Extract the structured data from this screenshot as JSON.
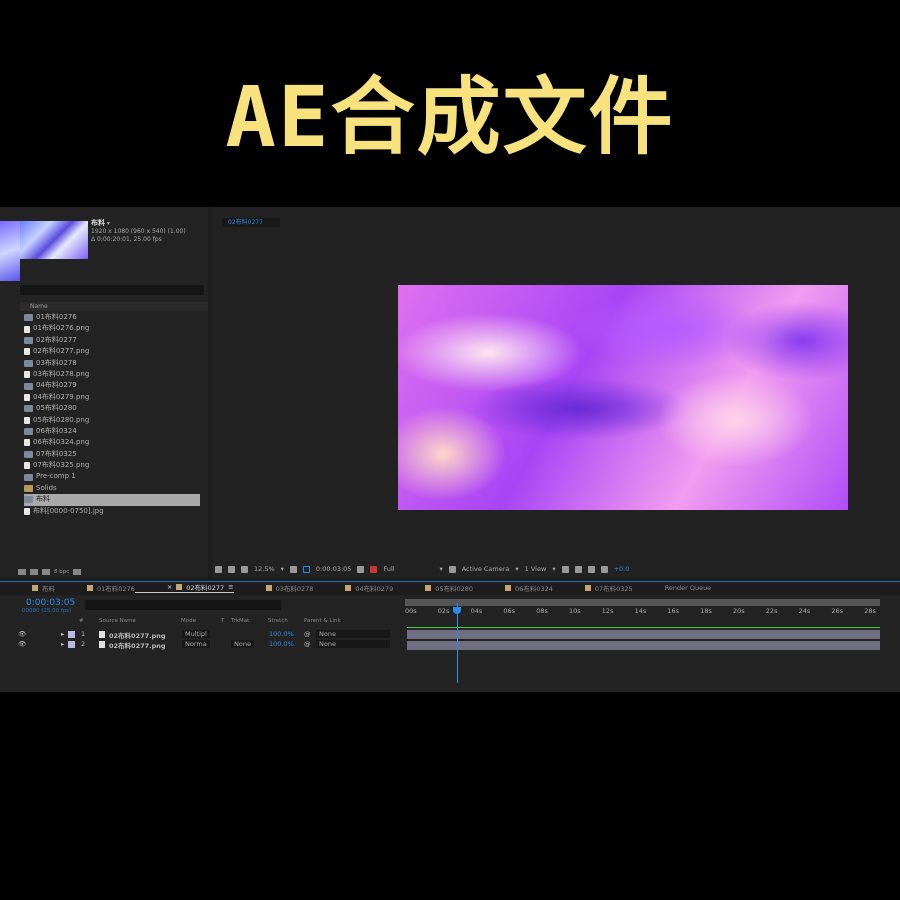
{
  "title": "AE合成文件",
  "project": {
    "comp_name": "布料",
    "resolution": "1920 x 1080  (960 x 540) (1.00)",
    "duration": "Δ 0:00:20:01, 25.00 fps",
    "column_name": "Name",
    "items": [
      {
        "label": "01布料0276",
        "type": "comp"
      },
      {
        "label": "01布料0276.png",
        "type": "png"
      },
      {
        "label": "02布料0277",
        "type": "comp"
      },
      {
        "label": "02布料0277.png",
        "type": "png"
      },
      {
        "label": "03布料0278",
        "type": "comp"
      },
      {
        "label": "03布料0278.png",
        "type": "png"
      },
      {
        "label": "04布料0279",
        "type": "comp"
      },
      {
        "label": "04布料0279.png",
        "type": "png"
      },
      {
        "label": "05布料0280",
        "type": "comp"
      },
      {
        "label": "05布料0280.png",
        "type": "png"
      },
      {
        "label": "06布料0324",
        "type": "comp"
      },
      {
        "label": "06布料0324.png",
        "type": "png"
      },
      {
        "label": "07布料0325",
        "type": "comp"
      },
      {
        "label": "07布料0325.png",
        "type": "png"
      },
      {
        "label": "Pre-comp 1",
        "type": "comp"
      },
      {
        "label": "Solids",
        "type": "folder"
      },
      {
        "label": "布料",
        "type": "comp",
        "selected": true
      },
      {
        "label": "布料[0000-0750].jpg",
        "type": "png"
      }
    ],
    "bpc": "8 bpc"
  },
  "viewer": {
    "tab": "02布料0277",
    "zoom": "12.5%",
    "timecode": "0:00:03:05",
    "resolution": "Full",
    "camera": "Active Camera",
    "views": "1 View",
    "exposure": "+0.0"
  },
  "tabs": [
    {
      "label": "布料"
    },
    {
      "label": "01布料0276"
    },
    {
      "label": "02布料0277",
      "active": true
    },
    {
      "label": "03布料0278"
    },
    {
      "label": "04布料0279"
    },
    {
      "label": "05布料0280"
    },
    {
      "label": "06布料0324"
    },
    {
      "label": "07布料0325"
    },
    {
      "label": "Render Queue",
      "plain": true
    }
  ],
  "timeline": {
    "timecode": "0:00:03:05",
    "frames": "00080 (25.00 fps)",
    "headers": {
      "num": "#",
      "source": "Source Name",
      "mode": "Mode",
      "t": "T",
      "trkmat": "TrkMat",
      "stretch": "Stretch",
      "parent": "Parent & Link"
    },
    "layers": [
      {
        "num": "1",
        "name": "02布料0277.png",
        "mode": "Multipl",
        "trkmat": "",
        "stretch": "100.0%",
        "parent": "None"
      },
      {
        "num": "2",
        "name": "02布料0277.png",
        "mode": "Norma",
        "trkmat": "None",
        "stretch": "100.0%",
        "parent": "None"
      }
    ],
    "ticks": [
      "00s",
      "02s",
      "04s",
      "06s",
      "08s",
      "10s",
      "12s",
      "14s",
      "16s",
      "18s",
      "20s",
      "22s",
      "24s",
      "26s",
      "28s"
    ],
    "current_time_seconds": 3.2
  },
  "colors": {
    "title": "#f8e27e",
    "accent": "#2d8ceb",
    "label": "#c5a572"
  }
}
